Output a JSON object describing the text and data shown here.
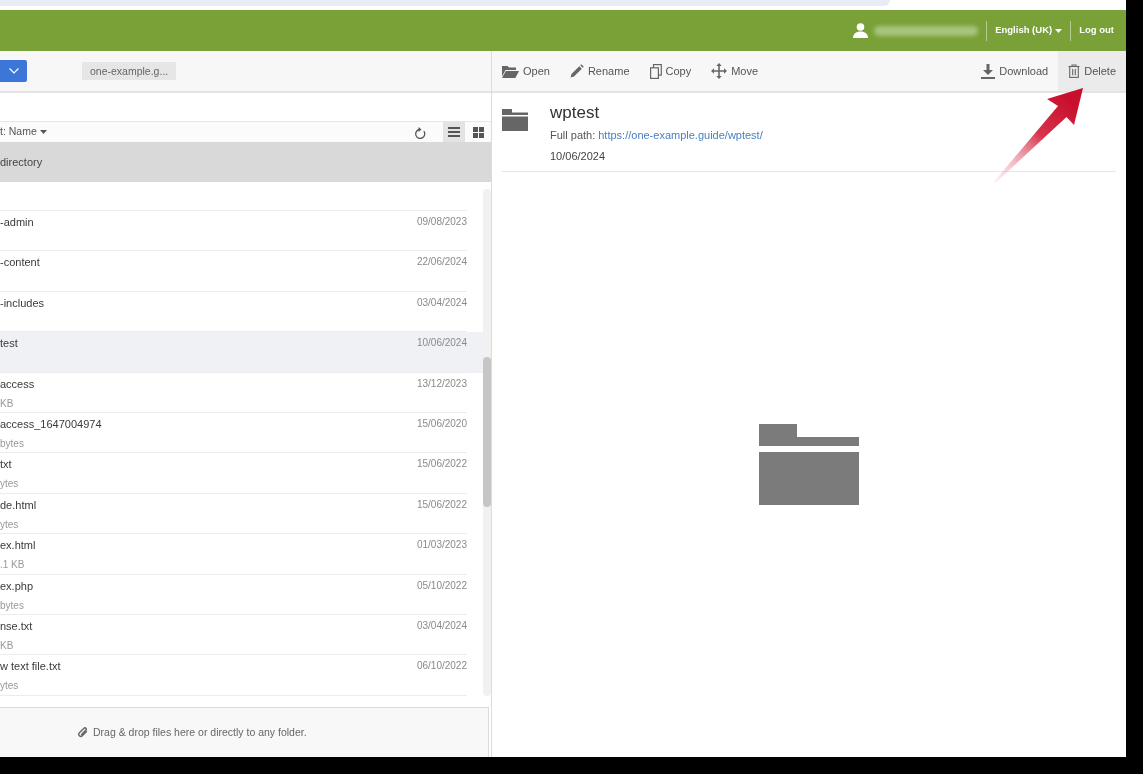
{
  "header": {
    "language": "English (UK)",
    "logout": "Log out"
  },
  "left_toolbar": {
    "path_chip": "one-example.g..."
  },
  "sort": {
    "label": "t: Name"
  },
  "views": [
    {
      "kind": "list",
      "selected": true
    },
    {
      "kind": "grid",
      "selected": false
    }
  ],
  "parent_row": {
    "name": "directory"
  },
  "files": [
    {
      "name": "-admin",
      "date": "09/08/2023",
      "selected": false
    },
    {
      "name": "-content",
      "date": "22/06/2024",
      "selected": false
    },
    {
      "name": "-includes",
      "date": "03/04/2024",
      "selected": false
    },
    {
      "name": "test",
      "date": "10/06/2024",
      "selected": true
    },
    {
      "name": "access",
      "size": "KB",
      "date": "13/12/2023",
      "selected": false
    },
    {
      "name": "access_1647004974",
      "size": "bytes",
      "date": "15/06/2020",
      "selected": false
    },
    {
      "name": "txt",
      "size": "ytes",
      "date": "15/06/2022",
      "selected": false
    },
    {
      "name": "de.html",
      "size": "ytes",
      "date": "15/06/2022",
      "selected": false
    },
    {
      "name": "ex.html",
      "size": ".1 KB",
      "date": "01/03/2023",
      "selected": false
    },
    {
      "name": "ex.php",
      "size": "bytes",
      "date": "05/10/2022",
      "selected": false
    },
    {
      "name": "nse.txt",
      "size": "KB",
      "date": "03/04/2024",
      "selected": false
    },
    {
      "name": "w text file.txt",
      "size": "ytes",
      "date": "06/10/2022",
      "selected": false
    }
  ],
  "drop_zone": {
    "text": "Drag & drop files here or directly to any folder."
  },
  "actions": [
    {
      "kind": "open",
      "label": "Open",
      "highlighted": false
    },
    {
      "kind": "rename",
      "label": "Rename",
      "highlighted": false
    },
    {
      "kind": "copy",
      "label": "Copy",
      "highlighted": false
    },
    {
      "kind": "move",
      "label": "Move",
      "highlighted": false
    }
  ],
  "actions_right": [
    {
      "kind": "download",
      "label": "Download",
      "highlighted": false
    },
    {
      "kind": "delete",
      "label": "Delete",
      "highlighted": true
    }
  ],
  "details": {
    "name": "wptest",
    "path_label": "Full path:",
    "path_link": "https://one-example.guide/wptest/",
    "date": "10/06/2024"
  }
}
